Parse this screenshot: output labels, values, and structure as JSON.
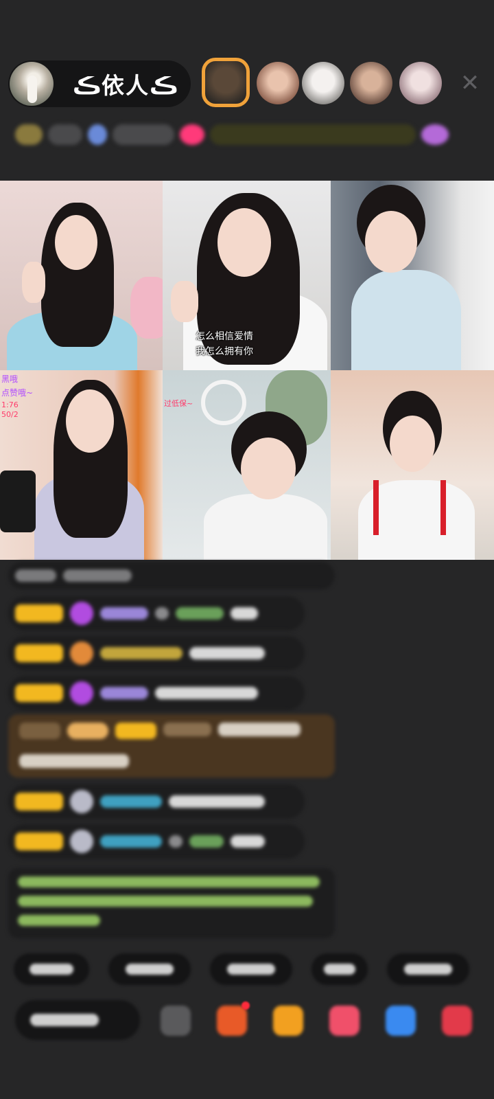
{
  "host": {
    "name": "ڪ依人ڪ"
  },
  "header": {
    "close_icon": "close-icon",
    "guest_avatars": [
      "guest-avatar-1",
      "guest-avatar-2",
      "guest-avatar-3",
      "guest-avatar-4",
      "guest-avatar-5"
    ]
  },
  "video_grid": {
    "tile_2_subtitle_line1": "怎么相信爱情",
    "tile_2_subtitle_line2": "我怎么拥有你",
    "tile_4_overlay_line1": "黑哦",
    "tile_4_overlay_line2": "点赞哦~",
    "tile_4_overlay_line3": "1:76",
    "tile_4_overlay_line4": "50/2",
    "tile_5_overlay": "过低保~"
  },
  "colors": {
    "background": "#262627",
    "active_guest_border": "#f0a23a",
    "badge_gold": "#f2b820",
    "promo_background": "#4a3620",
    "green_message": "#8cb95e"
  }
}
